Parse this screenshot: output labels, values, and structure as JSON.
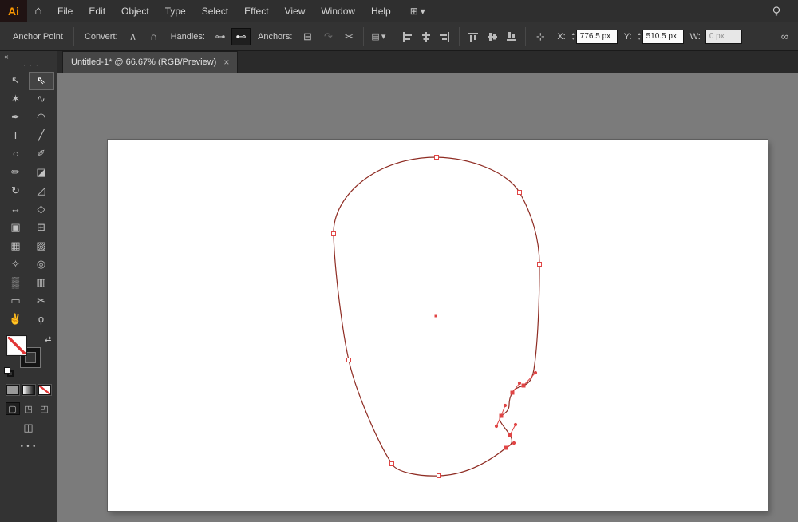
{
  "menu_bar": {
    "logo": "Ai",
    "items": [
      "File",
      "Edit",
      "Object",
      "Type",
      "Select",
      "Effect",
      "View",
      "Window",
      "Help"
    ]
  },
  "icons": {
    "home": "⌂",
    "workspace": "⊞",
    "chevron_down": "▾",
    "collapse": "«",
    "grip": "∙ ∙ ∙ ∙",
    "convert_corner": "∧",
    "convert_smooth": "∩",
    "handles_show": "⊶",
    "handles_hide": "⊷",
    "remove_anchor": "⊟",
    "connect_path": "↷",
    "cut_path": "✂",
    "style_box": "▤",
    "reference_point": "⊹",
    "stepper_up": "▴",
    "stepper_down": "▾",
    "constrain": "∞",
    "swap": "⇄",
    "draw_normal": "▢",
    "draw_behind": "◳",
    "draw_inside": "◰",
    "screen_mode": "◫",
    "more": "• • •"
  },
  "control_bar": {
    "context_label": "Anchor Point",
    "convert_label": "Convert:",
    "handles_label": "Handles:",
    "anchors_label": "Anchors:",
    "x_label": "X:",
    "x_value": "776.5 px",
    "y_label": "Y:",
    "y_value": "510.5 px",
    "w_label": "W:",
    "w_value": "0 px"
  },
  "document_tab": {
    "title": "Untitled-1* @ 66.67% (RGB/Preview)",
    "close": "×"
  },
  "toolbar": {
    "tools": [
      {
        "name": "selection",
        "glyph": "↖"
      },
      {
        "name": "direct-selection",
        "glyph": "⇖"
      },
      {
        "name": "magic-wand",
        "glyph": "✶"
      },
      {
        "name": "lasso",
        "glyph": "∿"
      },
      {
        "name": "pen",
        "glyph": "✒"
      },
      {
        "name": "curvature",
        "glyph": "◠"
      },
      {
        "name": "type",
        "glyph": "T"
      },
      {
        "name": "line-segment",
        "glyph": "╱"
      },
      {
        "name": "ellipse",
        "glyph": "○"
      },
      {
        "name": "paintbrush",
        "glyph": "✐"
      },
      {
        "name": "pencil",
        "glyph": "✏"
      },
      {
        "name": "eraser",
        "glyph": "◪"
      },
      {
        "name": "rotate",
        "glyph": "↻"
      },
      {
        "name": "scale",
        "glyph": "◿"
      },
      {
        "name": "width",
        "glyph": "↔"
      },
      {
        "name": "free-transform",
        "glyph": "◇"
      },
      {
        "name": "shape-builder",
        "glyph": "▣"
      },
      {
        "name": "perspective-grid",
        "glyph": "⊞"
      },
      {
        "name": "mesh",
        "glyph": "▦"
      },
      {
        "name": "gradient",
        "glyph": "▨"
      },
      {
        "name": "eyedropper",
        "glyph": "✧"
      },
      {
        "name": "blend",
        "glyph": "◎"
      },
      {
        "name": "symbol-sprayer",
        "glyph": "▒"
      },
      {
        "name": "column-graph",
        "glyph": "▥"
      },
      {
        "name": "artboard",
        "glyph": "▭"
      },
      {
        "name": "slice",
        "glyph": "✂"
      },
      {
        "name": "hand",
        "glyph": "✌"
      },
      {
        "name": "zoom",
        "glyph": "ϙ"
      }
    ]
  },
  "colors": {
    "accent_red": "#e04545",
    "path_stroke": "#8e2b22",
    "canvas_bg": "#7b7b7b",
    "artboard_bg": "#ffffff"
  }
}
